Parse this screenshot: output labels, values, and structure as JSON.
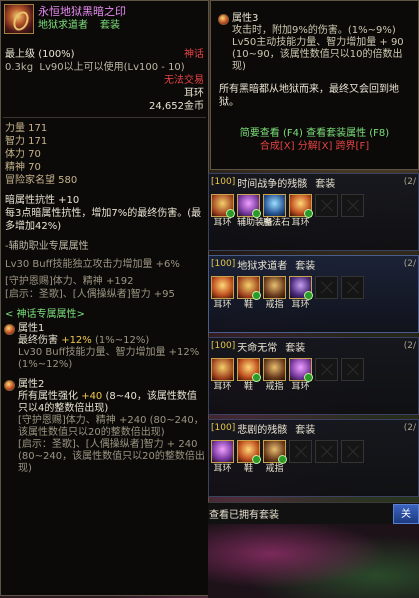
{
  "tooltip": {
    "name": "永恒地狱黑暗之印",
    "set_name": "地狱求道者",
    "set_label": "套装",
    "grade": "最上级",
    "grade_pct": "(100%)",
    "rarity": "神话",
    "weight": "0.3kg",
    "level_req": "Lv90以上可以使用(Lv100 - 10)",
    "trade": "无法交易",
    "slot": "耳环",
    "price": "24,652金币",
    "stats": [
      "力量 171",
      "智力 171",
      "体力 70",
      "精神 70",
      "冒险家名望 580"
    ],
    "dark_resist": "暗属性抗性 +10",
    "dark_effect": "每3点暗属性抗性，增加7%的最终伤害。(最多增加42%)",
    "support_title": "-辅助职业专属属性",
    "support_lines": [
      "Lv30 Buff技能独立攻击力增加量 +6%",
      "[守护恩赐]体力、精神 +192",
      "[启示：圣歌]、[人偶操纵者]智力 +95"
    ],
    "myth_title": "< 神话专属属性>",
    "attr1": {
      "title": "属性1",
      "line1_a": "最终伤害",
      "line1_b": "+12%",
      "line1_c": "(1%~12%)",
      "line2": "Lv30 Buff技能力量、智力增加量 +12% (1%~12%)"
    },
    "attr2": {
      "title": "属性2",
      "line1_a": "所有属性强化",
      "line1_b": "+40",
      "line1_c": "(8~40，该属性数值只以4的整数倍出现)",
      "line2": "[守护恩赐]体力、精神 +240 (80~240，该属性数值只以20的整数倍出现)",
      "line3": "[启示：圣歌]、[人偶操纵者]智力 + 240 (80~240，该属性数值只以20的整数倍出现)"
    }
  },
  "panel": {
    "attr3_title": "属性3",
    "attr3_text": "攻击时，附加9%的伤害。(1%~9%) Lv50主动技能力量、智力增加量 + 90 (10~90，该属性数值只以10的倍数出现)",
    "lore": "所有黑暗都从地狱而来，最终又会回到地狱。",
    "link_brief": "简要查看 (F4)",
    "link_set": "查看套装属性 (F8)",
    "link_compose": "合成[X]",
    "link_decompose": "分解[X]",
    "link_transfer": "跨界[F]"
  },
  "sets": [
    {
      "count": "[100]",
      "title": "时间战争的残骸",
      "tag": "套装",
      "right": "(2/",
      "slots": [
        "g1",
        "g2",
        "g3",
        "g4",
        "empty",
        "empty"
      ],
      "labels": [
        "耳环",
        "辅助装备",
        "魔法石",
        "耳环",
        "",
        ""
      ]
    },
    {
      "count": "[100]",
      "title": "地狱求道者",
      "tag": "套装",
      "right": "(2/",
      "slots": [
        "g4",
        "g1",
        "g5",
        "g6",
        "empty",
        "empty"
      ],
      "labels": [
        "耳环",
        "鞋",
        "戒指",
        "耳环",
        "",
        ""
      ]
    },
    {
      "count": "[100]",
      "title": "天命无常",
      "tag": "套装",
      "right": "(2/",
      "slots": [
        "g1",
        "g4",
        "g5",
        "g2",
        "empty",
        "empty"
      ],
      "labels": [
        "耳环",
        "鞋",
        "戒指",
        "耳环",
        "",
        ""
      ]
    },
    {
      "count": "[100]",
      "title": "悲剧的残骸",
      "tag": "套装",
      "right": "(2/",
      "slots": [
        "g2",
        "g4",
        "g5",
        "empty",
        "empty",
        "empty"
      ],
      "labels": [
        "耳环",
        "鞋",
        "戒指",
        "",
        "",
        ""
      ]
    }
  ],
  "bottom": {
    "owned_label": "查看已拥有套装",
    "button": "关"
  },
  "colors": {
    "name": "#e58cf0",
    "set": "#7de07a",
    "red": "#e64343",
    "gold": "#f2c94c"
  }
}
